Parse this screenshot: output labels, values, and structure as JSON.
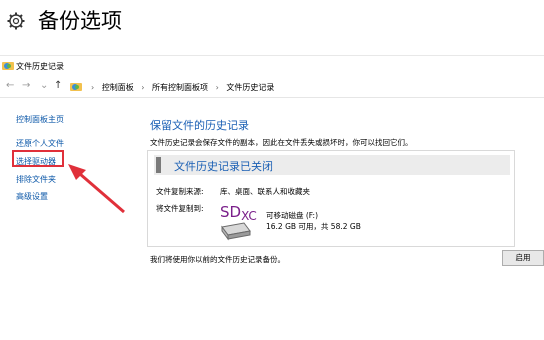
{
  "settings": {
    "title": "备份选项"
  },
  "window": {
    "title": "文件历史记录"
  },
  "address_bar": {
    "breadcrumbs": [
      "控制面板",
      "所有控制面板项",
      "文件历史记录"
    ]
  },
  "sidebar": {
    "home": "控制面板主页",
    "restore": "还原个人文件",
    "select_drive": "选择驱动器",
    "exclude": "排除文件夹",
    "advanced": "高级设置"
  },
  "main": {
    "heading": "保留文件的历史记录",
    "description": "文件历史记录会保存文件的副本，因此在文件丢失或损坏时，你可以找回它们。",
    "status": "文件历史记录已关闭",
    "copy_from_label": "文件复制来源:",
    "copy_from_value": "库、桌面、联系人和收藏夹",
    "copy_to_label": "将文件复制到:",
    "drive_logo": "SD",
    "drive_logo_sub": "XC",
    "drive_name": "可移动磁盘 (F:)",
    "drive_space": "16.2 GB 可用，共 58.2 GB",
    "footer_note": "我们将使用你以前的文件历史记录备份。",
    "enable_button": "启用"
  },
  "colors": {
    "link": "#0b57a8",
    "heading": "#1a5fb4",
    "highlight": "#e0303a",
    "logo": "#7a1f8a"
  }
}
